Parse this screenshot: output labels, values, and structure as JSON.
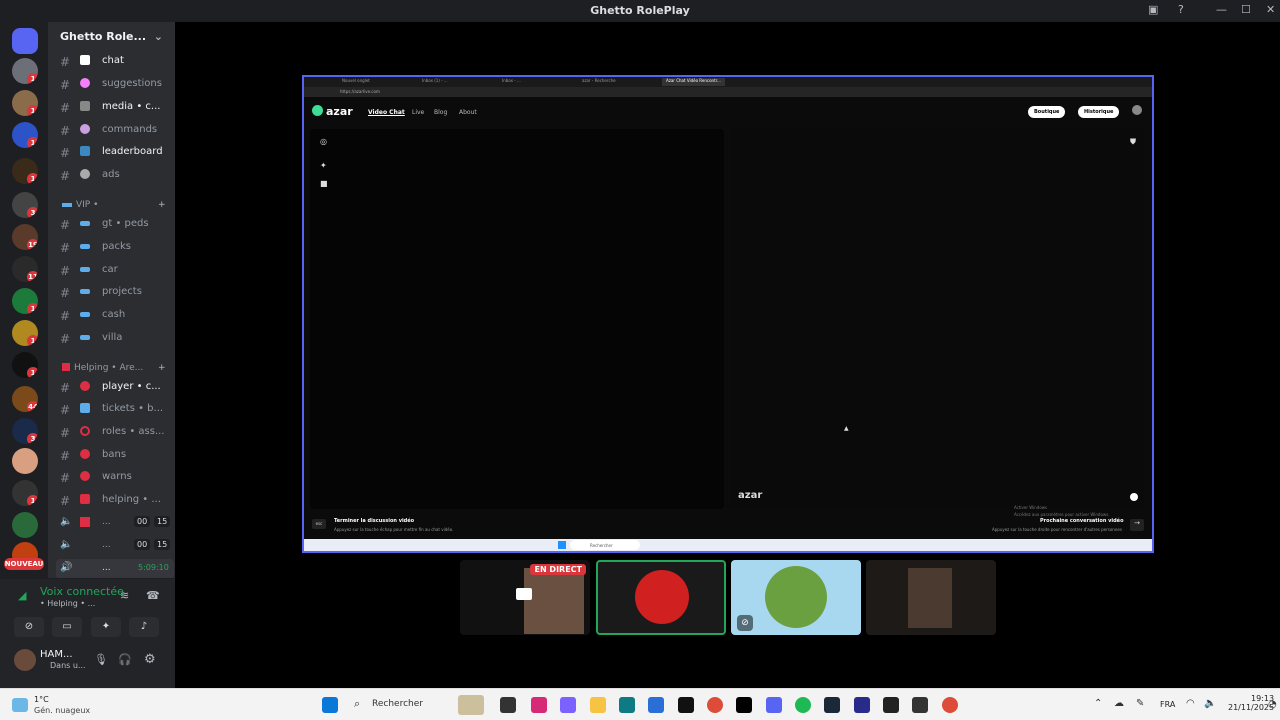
{
  "window": {
    "title": "Ghetto RolePlay"
  },
  "guild": {
    "name": "Ghetto Role..."
  },
  "channels": [
    {
      "label": "chat",
      "bright": true
    },
    {
      "label": "suggestions",
      "bright": false
    },
    {
      "label": "media • c...",
      "bright": true
    },
    {
      "label": "commands",
      "bright": false
    },
    {
      "label": "leaderboard",
      "bright": true
    },
    {
      "label": "ads",
      "bright": false
    }
  ],
  "categories": {
    "vip": "VIP • ",
    "helping": "Helping • Are..."
  },
  "vip_channels": [
    "gt • peds",
    "packs",
    "car",
    "projects",
    "cash",
    "villa"
  ],
  "helping_channels": [
    {
      "label": "player • c...",
      "bright": true
    },
    {
      "label": "tickets • b...",
      "bright": false
    },
    {
      "label": "roles • ass...",
      "bright": false
    },
    {
      "label": "bans",
      "bright": false
    },
    {
      "label": "warns",
      "bright": false
    },
    {
      "label": "helping • ...",
      "bright": false
    }
  ],
  "voice_channels": [
    {
      "label": "...",
      "a": "00",
      "b": "15"
    },
    {
      "label": "...",
      "a": "00",
      "b": "15"
    },
    {
      "label": "...",
      "timer": "5:09:10"
    }
  ],
  "server_badges": [
    "1",
    "1",
    "1",
    "1",
    "3",
    "19",
    "11",
    "1",
    "1",
    "1",
    "44",
    "3",
    "1",
    "1"
  ],
  "server_new_label": "NOUVEAU",
  "voice_panel": {
    "status": "Voix connectée",
    "sub": "• Helping • ..."
  },
  "user": {
    "name": "HAM...",
    "status": "Dans u..."
  },
  "browser": {
    "tabs": [
      "Nouvel onglet",
      "Inbox (1) - ...",
      "Inbox - ...",
      "azar - Recherche",
      "Azar Chat Vidéo Rencontr..."
    ],
    "url": "https://azarlive.com",
    "nav": {
      "video_chat": "Video Chat",
      "live": "Live",
      "blog": "Blog",
      "about": "About"
    },
    "buttons": {
      "boutique": "Boutique",
      "historique": "Historique"
    },
    "logo": "azar",
    "footer_left_key": "esc",
    "footer_left_title": "Terminer la discussion vidéo",
    "footer_left_sub": "Appuyez sur la touche échap pour mettre fin au chat vidéo.",
    "footer_right_title": "Prochaine conversation vidéo",
    "footer_right_sub": "Appuyez sur la touche droite pour rencontrer d'autres personnes",
    "activate_title": "Activer Windows",
    "activate_sub": "Accédez aux paramètres pour activer Windows.",
    "inner_search": "Rechercher"
  },
  "stream_badge": "EN DIRECT",
  "taskbar": {
    "weather_temp": "1°C",
    "weather_desc": "Gén. nuageux",
    "search": "Rechercher",
    "lang": "FRA",
    "time": "19:13",
    "date": "21/11/2025"
  },
  "colors": {
    "accent": "#5865f2",
    "green": "#23a55a",
    "red": "#da373c"
  }
}
